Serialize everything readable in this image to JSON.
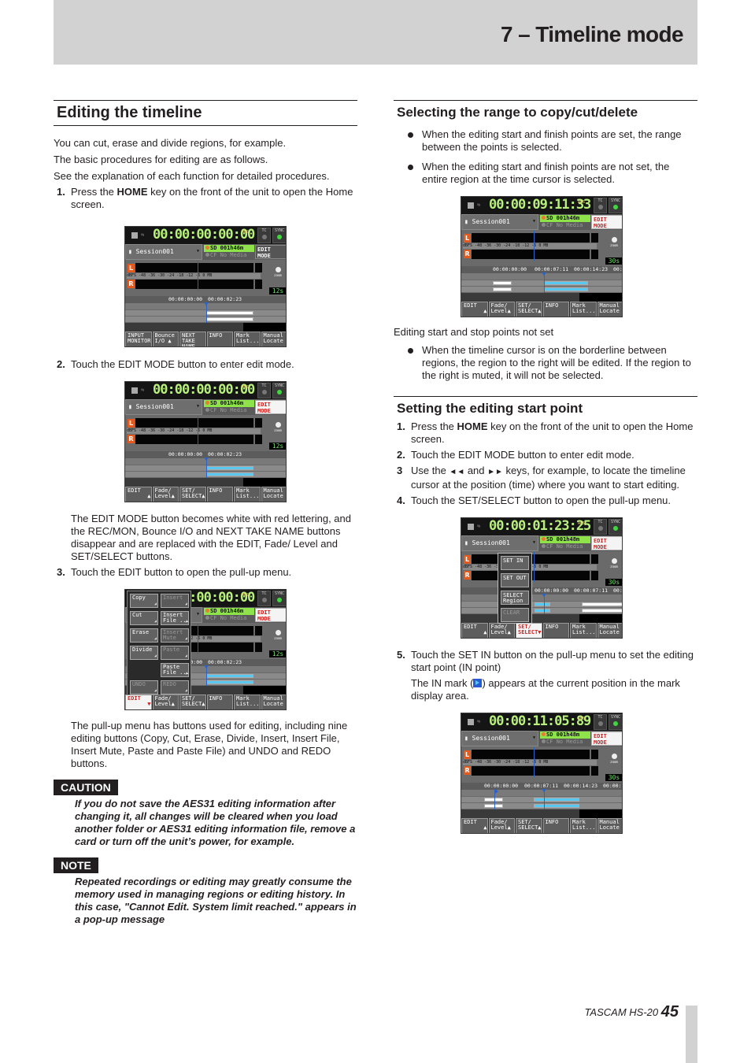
{
  "header": {
    "chapter_title": "7 – Timeline mode"
  },
  "left": {
    "heading": "Editing the timeline",
    "intro": [
      "You can cut, erase and divide regions, for example.",
      "The basic procedures for editing are as follows.",
      "See the explanation of each function for detailed procedures."
    ],
    "step1": {
      "num": "1.",
      "pre": "Press the ",
      "key": "HOME",
      "post": " key on the front of the unit to open the Home screen."
    },
    "step2": {
      "num": "2.",
      "text": "Touch the EDIT MODE button to enter edit mode."
    },
    "step2_note": "The EDIT MODE button becomes white with red lettering, and the REC/MON, Bounce I/O and NEXT TAKE NAME buttons disappear and are replaced with the EDIT, Fade/ Level and SET/SELECT buttons.",
    "step3": {
      "num": "3.",
      "text": "Touch the EDIT button to open the pull-up menu."
    },
    "step3_note": "The pull-up menu has buttons used for editing, including nine editing buttons (Copy, Cut, Erase, Divide, Insert, Insert File, Insert Mute, Paste and Paste File) and UNDO and REDO buttons.",
    "caution": {
      "label": "CAUTION",
      "text": "If you do not save the AES31 editing information after changing it, all changes will be cleared when you load another folder or AES31 editing information file, remove a card or turn off the unit’s power, for example."
    },
    "note": {
      "label": "NOTE",
      "text": "Repeated recordings or editing may greatly consume the memory used in managing regions or editing history. In this case, \"Cannot Edit. System limit reached.\" appears in a pop-up message"
    }
  },
  "right": {
    "heading1": "Selecting the range to copy/cut/delete",
    "bullets1": [
      "When the editing start and finish points are set, the range between the points is selected.",
      "When the editing start and finish points are not set, the entire region at the time cursor is selected."
    ],
    "screen_caption": "Editing start and stop points not set",
    "bullets2": [
      "When the timeline cursor is on the borderline between regions, the region to the right will be edited. If the region to the right is muted, it will not be selected."
    ],
    "heading2": "Setting the editing start point",
    "step1": {
      "num": "1.",
      "pre": "Press the ",
      "key": "HOME",
      "post": " key on the front of the unit to open the Home screen."
    },
    "step2": {
      "num": "2.",
      "text": "Touch the EDIT MODE button to enter edit mode."
    },
    "step3": {
      "num": "3",
      "pre": "Use the ",
      "rew": "◄◄",
      "mid": " and ",
      "ff": "►►",
      "post": " keys, for example, to locate the timeline cursor at the position (time) where you want to start editing."
    },
    "step4": {
      "num": "4.",
      "text": "Touch the SET/SELECT button to open the pull-up menu."
    },
    "step5": {
      "num": "5.",
      "text": "Touch the SET IN button on the pull-up menu to set the editing start point (IN point)"
    },
    "step5_note_pre": "The IN mark (",
    "step5_note_post": ") appears at the current position in the mark display area."
  },
  "screens": {
    "common": {
      "session": "Session001",
      "sd": "SD  001h46m",
      "cf": "CF No Media",
      "abs": "ABS",
      "tc": "TC",
      "sync": "SYNC",
      "scale": "dBFS -48 -36  -30  -24   -18   -12   -6    0 MB",
      "zoom_label": "zoom"
    },
    "home": {
      "time": "00:00:00:00",
      "frames": "00",
      "zoom": "12s",
      "edit_mode": "EDIT\nMODE",
      "ruler": [
        "00:00:00:00",
        "00:00:02:23"
      ],
      "buttons": [
        "INPUT\nMONITOR ▲",
        "Bounce\nI/O ▲",
        "NEXT\nTAKE\nNAME",
        "INFO",
        "Mark\nList...",
        "Manual\nLocate"
      ]
    },
    "edit": {
      "zoom": "12s",
      "buttons": [
        "EDIT\n      ▲",
        "Fade/\nLevel▲",
        "SET/\nSELECT▲",
        "INFO",
        "Mark\nList...",
        "Manual\nLocate"
      ],
      "edit_menu": [
        {
          "label": "Copy",
          "enabled": true
        },
        {
          "label": "Insert",
          "enabled": false
        },
        {
          "label": "Cut",
          "enabled": true
        },
        {
          "label": "Insert\nFile ...",
          "enabled": true
        },
        {
          "label": "Erase",
          "enabled": true
        },
        {
          "label": "Insert\nMute",
          "enabled": false
        },
        {
          "label": "Divide",
          "enabled": true
        },
        {
          "label": "Paste",
          "enabled": false
        },
        {
          "label": "Paste\nFile ...",
          "enabled": true
        },
        {
          "label": "UNDO",
          "enabled": false
        },
        {
          "label": "REDO",
          "enabled": false
        }
      ]
    },
    "select": {
      "time": "00:00:09:11",
      "frames": "33",
      "zoom": "30s",
      "ruler": [
        "00:00:00:00",
        "00:00:07:11",
        "00:00:14:23",
        "00:"
      ]
    },
    "setsel": {
      "time": "00:00:01:23",
      "frames": "25",
      "sd": "SD  001h48m",
      "zoom": "30s",
      "ruler": [
        "00:00:00:00",
        "00:00:07:11",
        "00:"
      ],
      "menu": [
        {
          "label": "SET IN",
          "enabled": true
        },
        {
          "label": "SET OUT",
          "enabled": true
        },
        {
          "label": "SELECT\nRegion",
          "enabled": true
        },
        {
          "label": "CLEAR",
          "enabled": false
        }
      ]
    },
    "setin": {
      "time": "00:00:11:05",
      "frames": "89",
      "sd": "SD  001h48m",
      "zoom": "30s",
      "ruler": [
        "00:00:00:00",
        "00:00:07:11",
        "00:00:14:23",
        "00:00:"
      ]
    }
  },
  "footer": {
    "product": "TASCAM HS-20",
    "page": "45"
  }
}
